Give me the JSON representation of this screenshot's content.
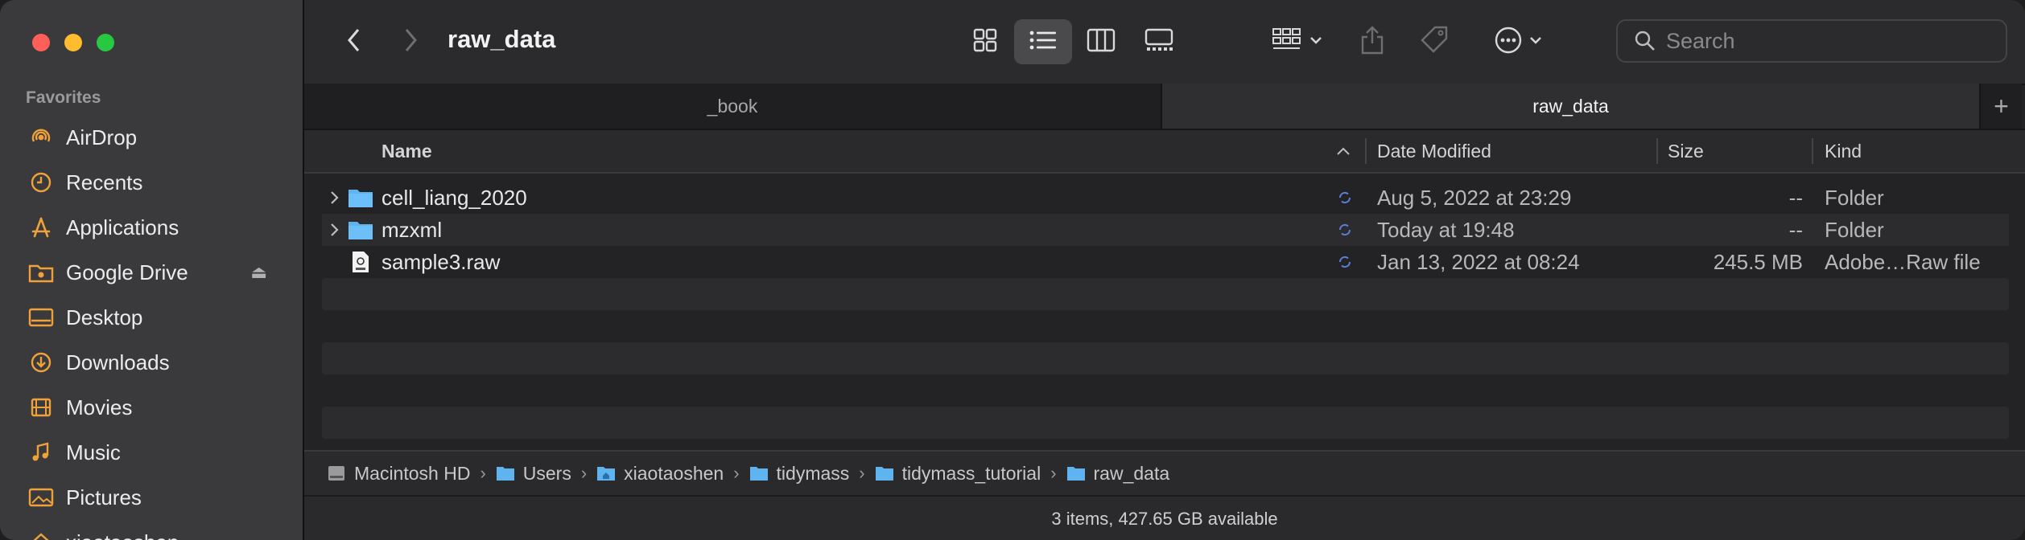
{
  "window": {
    "title": "raw_data"
  },
  "sidebar": {
    "heading": "Favorites",
    "items": [
      {
        "label": "AirDrop",
        "icon": "airdrop-icon"
      },
      {
        "label": "Recents",
        "icon": "clock-icon"
      },
      {
        "label": "Applications",
        "icon": "applications-icon"
      },
      {
        "label": "Google Drive",
        "icon": "drive-folder-icon"
      },
      {
        "label": "Desktop",
        "icon": "desktop-icon"
      },
      {
        "label": "Downloads",
        "icon": "downloads-icon"
      },
      {
        "label": "Movies",
        "icon": "film-icon"
      },
      {
        "label": "Music",
        "icon": "music-note-icon"
      },
      {
        "label": "Pictures",
        "icon": "photo-icon"
      },
      {
        "label": "xiaotaoshen",
        "icon": "home-icon"
      }
    ]
  },
  "toolbar": {
    "search_placeholder": "Search"
  },
  "tabs": [
    {
      "label": "_book"
    },
    {
      "label": "raw_data"
    }
  ],
  "columns": {
    "name": "Name",
    "date_modified": "Date Modified",
    "size": "Size",
    "kind": "Kind"
  },
  "files": [
    {
      "name": "cell_liang_2020",
      "date": "Aug 5, 2022 at 23:29",
      "size": "--",
      "kind": "Folder"
    },
    {
      "name": "mzxml",
      "date": "Today at 19:48",
      "size": "--",
      "kind": "Folder"
    },
    {
      "name": "sample3.raw",
      "date": "Jan 13, 2022 at 08:24",
      "size": "245.5 MB",
      "kind": "Adobe…Raw file"
    }
  ],
  "pathbar": [
    {
      "label": "Macintosh HD"
    },
    {
      "label": "Users"
    },
    {
      "label": "xiaotaoshen"
    },
    {
      "label": "tidymass"
    },
    {
      "label": "tidymass_tutorial"
    },
    {
      "label": "raw_data"
    }
  ],
  "status": "3 items, 427.65 GB available",
  "colors": {
    "accent": "#f0a23a",
    "folder": "#5fb4f0",
    "sync": "#5b7fd6"
  }
}
